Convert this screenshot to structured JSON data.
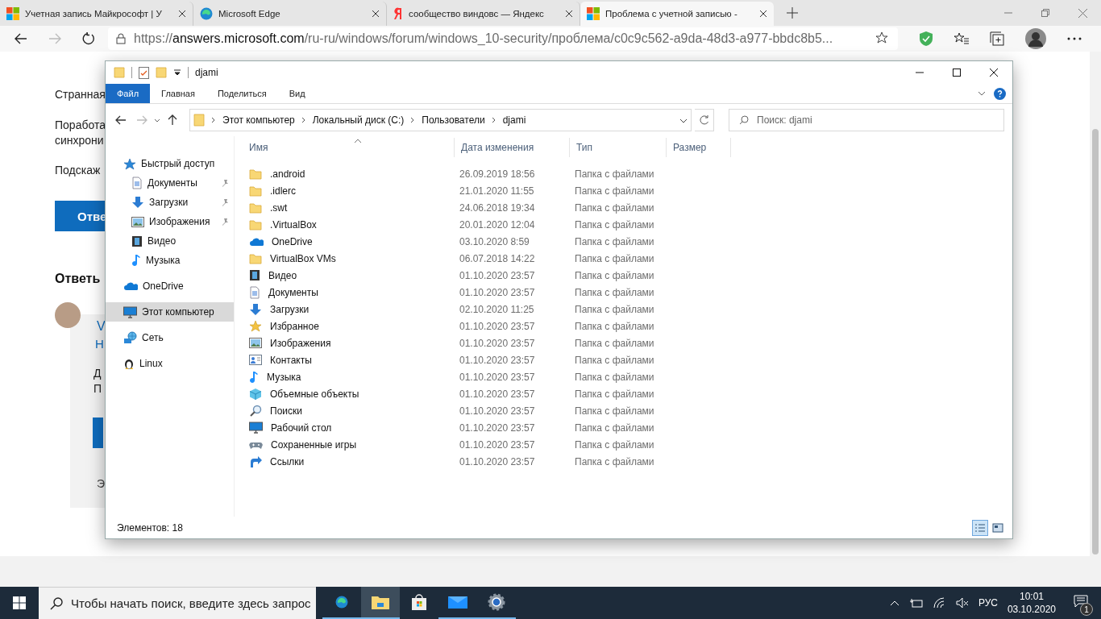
{
  "browser": {
    "tabs": [
      {
        "title": "Учетная запись Майкрософт | У",
        "kind": "windows",
        "selected": false
      },
      {
        "title": "Microsoft Edge",
        "kind": "edge",
        "selected": false
      },
      {
        "title": "сообщество виндовс — Яндекс",
        "kind": "yandex",
        "selected": false
      },
      {
        "title": "Проблема с учетной записью -",
        "kind": "windows",
        "selected": true
      }
    ],
    "address": {
      "scheme": "https://",
      "host": "answers.microsoft.com",
      "path": "/ru-ru/windows/forum/windows_10-security/проблема/c0c9c562-a9da-48d3-a977-bbdc8b5..."
    }
  },
  "page": {
    "lines": [
      "Странная",
      "Поработа",
      "синхрони",
      "Подскаж"
    ],
    "reply_button": "Отве",
    "answers_heading": "Ответь",
    "reply": {
      "author": "V",
      "subtitle": "Н",
      "lines": [
        "Д",
        "П"
      ],
      "footer": "Э"
    }
  },
  "explorer": {
    "title": "djami",
    "ribbon_tabs": [
      {
        "label": "Файл",
        "selected": true
      },
      {
        "label": "Главная",
        "selected": false
      },
      {
        "label": "Поделиться",
        "selected": false
      },
      {
        "label": "Вид",
        "selected": false
      }
    ],
    "breadcrumbs": [
      "Этот компьютер",
      "Локальный диск (C:)",
      "Пользователи",
      "djami"
    ],
    "search": {
      "placeholder": "Поиск: djami"
    },
    "nav": [
      {
        "label": "Быстрый доступ",
        "kind": "quick",
        "selected": false,
        "children": [
          {
            "label": "Документы",
            "kind": "documents",
            "pinned": true,
            "selected": false
          },
          {
            "label": "Загрузки",
            "kind": "downloads",
            "pinned": true,
            "selected": false
          },
          {
            "label": "Изображения",
            "kind": "pictures",
            "pinned": true,
            "selected": false
          },
          {
            "label": "Видео",
            "kind": "video",
            "pinned": false,
            "selected": false
          },
          {
            "label": "Музыка",
            "kind": "music",
            "pinned": false,
            "selected": false
          }
        ]
      },
      {
        "label": "OneDrive",
        "kind": "onedrive",
        "selected": false
      },
      {
        "label": "Этот компьютер",
        "kind": "computer",
        "selected": true
      },
      {
        "label": "Сеть",
        "kind": "network",
        "selected": false
      },
      {
        "label": "Linux",
        "kind": "linux",
        "selected": false
      }
    ],
    "columns": [
      "Имя",
      "Дата изменения",
      "Тип",
      "Размер"
    ],
    "files": [
      {
        "name": ".android",
        "kind": "folder",
        "date": "26.09.2019 18:56",
        "type": "Папка с файлами"
      },
      {
        "name": ".idlerc",
        "kind": "folder",
        "date": "21.01.2020 11:55",
        "type": "Папка с файлами"
      },
      {
        "name": ".swt",
        "kind": "folder",
        "date": "24.06.2018 19:34",
        "type": "Папка с файлами"
      },
      {
        "name": ".VirtualBox",
        "kind": "folder",
        "date": "20.01.2020 12:04",
        "type": "Папка с файлами"
      },
      {
        "name": "OneDrive",
        "kind": "onedrive",
        "date": "03.10.2020 8:59",
        "type": "Папка с файлами"
      },
      {
        "name": "VirtualBox VMs",
        "kind": "folder",
        "date": "06.07.2018 14:22",
        "type": "Папка с файлами"
      },
      {
        "name": "Видео",
        "kind": "video",
        "date": "01.10.2020 23:57",
        "type": "Папка с файлами"
      },
      {
        "name": "Документы",
        "kind": "documents",
        "date": "01.10.2020 23:57",
        "type": "Папка с файлами"
      },
      {
        "name": "Загрузки",
        "kind": "downloads",
        "date": "02.10.2020 11:25",
        "type": "Папка с файлами"
      },
      {
        "name": "Избранное",
        "kind": "favorites",
        "date": "01.10.2020 23:57",
        "type": "Папка с файлами"
      },
      {
        "name": "Изображения",
        "kind": "pictures",
        "date": "01.10.2020 23:57",
        "type": "Папка с файлами"
      },
      {
        "name": "Контакты",
        "kind": "contacts",
        "date": "01.10.2020 23:57",
        "type": "Папка с файлами"
      },
      {
        "name": "Музыка",
        "kind": "music",
        "date": "01.10.2020 23:57",
        "type": "Папка с файлами"
      },
      {
        "name": "Объемные объекты",
        "kind": "objects3d",
        "date": "01.10.2020 23:57",
        "type": "Папка с файлами"
      },
      {
        "name": "Поиски",
        "kind": "searches",
        "date": "01.10.2020 23:57",
        "type": "Папка с файлами"
      },
      {
        "name": "Рабочий стол",
        "kind": "desktop",
        "date": "01.10.2020 23:57",
        "type": "Папка с файлами"
      },
      {
        "name": "Сохраненные игры",
        "kind": "games",
        "date": "01.10.2020 23:57",
        "type": "Папка с файлами"
      },
      {
        "name": "Ссылки",
        "kind": "links",
        "date": "01.10.2020 23:57",
        "type": "Папка с файлами"
      }
    ],
    "status": "Элементов: 18",
    "views": [
      {
        "kind": "details",
        "selected": true
      },
      {
        "kind": "tiles",
        "selected": false
      }
    ]
  },
  "taskbar": {
    "search_placeholder": "Чтобы начать поиск, введите здесь запрос",
    "apps": [
      {
        "kind": "edge",
        "selected": false,
        "running": true
      },
      {
        "kind": "explorer",
        "selected": true,
        "running": true
      },
      {
        "kind": "store",
        "selected": false,
        "running": false
      },
      {
        "kind": "mail",
        "selected": false,
        "running": true
      },
      {
        "kind": "settings",
        "selected": false,
        "running": true
      }
    ],
    "language": "РУС",
    "time": "10:01",
    "date": "03.10.2020",
    "notifications": "1"
  }
}
